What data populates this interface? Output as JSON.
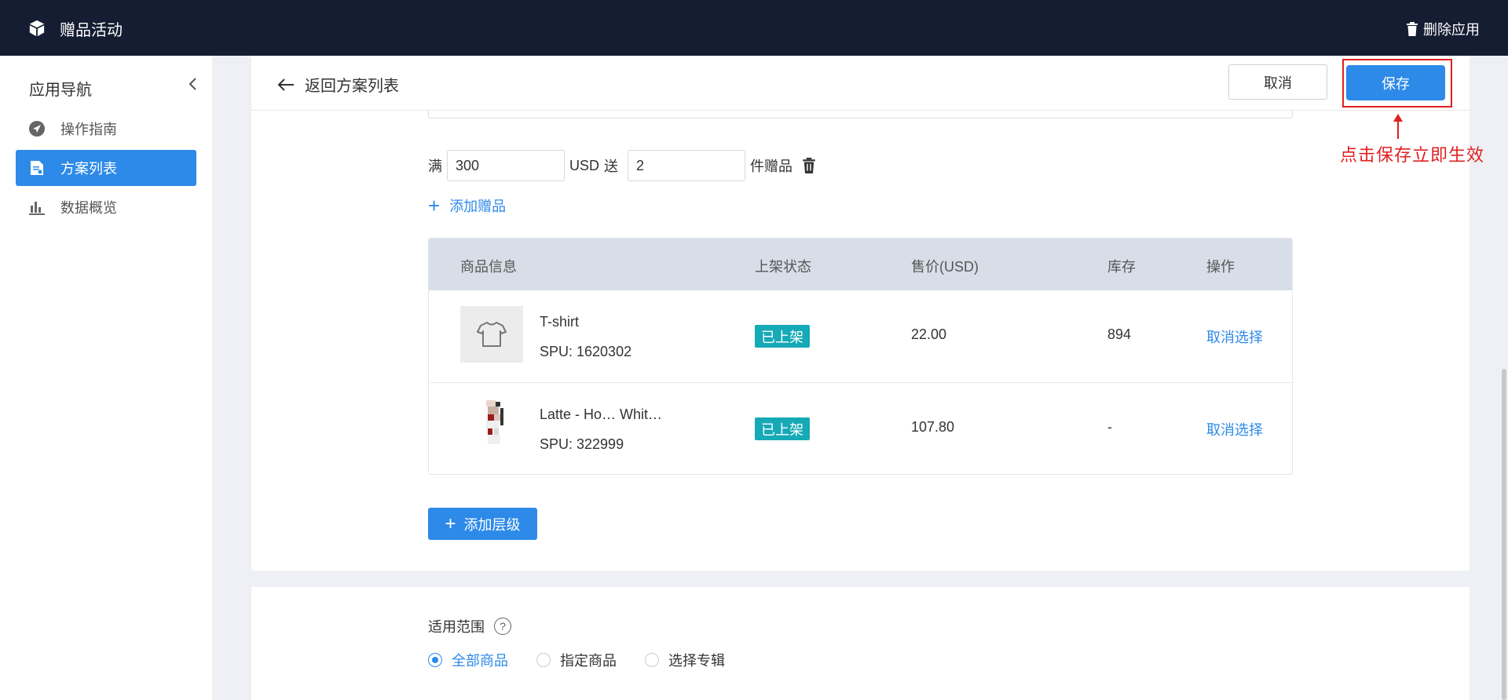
{
  "topbar": {
    "app_title": "赠品活动",
    "delete_app": "删除应用",
    "app_icon": "cube-icon",
    "delete_icon": "trash-icon"
  },
  "sidebar": {
    "title": "应用导航",
    "items": [
      {
        "label": "操作指南",
        "icon": "navigation-icon",
        "active": false
      },
      {
        "label": "方案列表",
        "icon": "document-list-icon",
        "active": true
      },
      {
        "label": "数据概览",
        "icon": "bar-chart-icon",
        "active": false
      }
    ]
  },
  "header": {
    "back_label": "返回方案列表",
    "cancel_label": "取消",
    "save_label": "保存"
  },
  "tier": {
    "prefix": "满",
    "threshold": "300",
    "currency": "USD",
    "give_label": "送",
    "gift_count": "2",
    "suffix": "件赠品",
    "add_gift_label": "添加赠品"
  },
  "table": {
    "headers": [
      "商品信息",
      "上架状态",
      "售价(USD)",
      "库存",
      "操作"
    ],
    "rows": [
      {
        "name": "T-shirt",
        "spu": "SPU: 1620302",
        "status": "已上架",
        "price": "22.00",
        "stock": "894",
        "action": "取消选择"
      },
      {
        "name": "Latte - Ho… Whit…",
        "spu": "SPU: 322999",
        "status": "已上架",
        "price": "107.80",
        "stock": "-",
        "action": "取消选择"
      }
    ]
  },
  "add_tier_label": "添加层级",
  "scope": {
    "label": "适用范围",
    "help_icon": "question-icon",
    "options": [
      "全部商品",
      "指定商品",
      "选择专辑"
    ],
    "selected": "全部商品"
  },
  "annotation": {
    "text": "点击保存立即生效",
    "color": "#e02020"
  },
  "colors": {
    "topbar_bg": "#151d33",
    "accent": "#2d8ae8",
    "badge": "#16a9b6"
  }
}
